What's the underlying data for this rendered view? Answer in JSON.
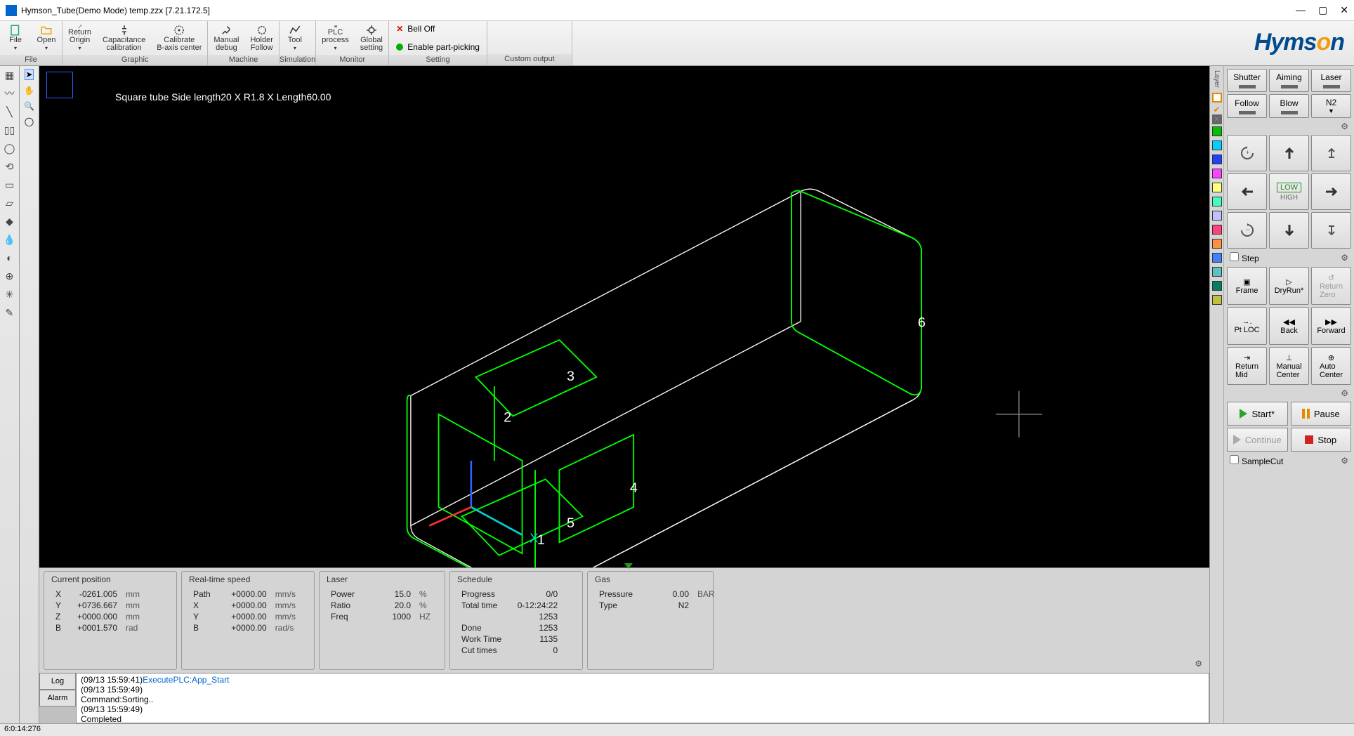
{
  "titlebar": {
    "icon_name": "app-icon",
    "title": "Hymson_Tube(Demo Mode) temp.zzx  [7.21.172.5]"
  },
  "ribbon": {
    "file": {
      "label": "File",
      "items": [
        {
          "label": "File",
          "name": "file-button"
        },
        {
          "label": "Open",
          "name": "open-button"
        }
      ]
    },
    "graphic": {
      "label": "Graphic",
      "items": [
        {
          "label": "Return\nOrigin",
          "name": "return-origin-button"
        },
        {
          "label": "Capacitance\ncalibration",
          "name": "capacitance-calibration-button"
        },
        {
          "label": "Calibrate\nB-axis center",
          "name": "calibrate-b-axis-button"
        }
      ]
    },
    "machine": {
      "label": "Machine",
      "items": [
        {
          "label": "Manual\ndebug",
          "name": "manual-debug-button"
        },
        {
          "label": "Holder\nFollow",
          "name": "holder-follow-button"
        }
      ]
    },
    "simulation": {
      "label": "Simulation",
      "items": [
        {
          "label": "Tool",
          "name": "tool-button"
        }
      ]
    },
    "monitor": {
      "label": "Monitor",
      "items": [
        {
          "label": "PLC\nprocess",
          "name": "plc-process-button"
        },
        {
          "label": "Global\nsetting",
          "name": "global-setting-button"
        }
      ]
    },
    "setting": {
      "label": "Setting",
      "bell_off": "Bell Off",
      "enable_part_picking": "Enable part-picking"
    },
    "custom_output": {
      "label": "Custom output"
    },
    "brand": "Hymson"
  },
  "viewport": {
    "tube_label": "Square tube Side length20 X R1.8 X Length60.00",
    "numbers": [
      "1",
      "2",
      "3",
      "4",
      "5",
      "6"
    ],
    "axis_x": "X"
  },
  "status_panels": {
    "current_position": {
      "title": "Current position",
      "rows": [
        {
          "axis": "X",
          "value": "-0261.005",
          "unit": "mm"
        },
        {
          "axis": "Y",
          "value": "+0736.667",
          "unit": "mm"
        },
        {
          "axis": "Z",
          "value": "+0000.000",
          "unit": "mm"
        },
        {
          "axis": "B",
          "value": "+0001.570",
          "unit": "rad"
        }
      ]
    },
    "real_time_speed": {
      "title": "Real-time speed",
      "rows": [
        {
          "axis": "Path",
          "value": "+0000.00",
          "unit": "mm/s"
        },
        {
          "axis": "X",
          "value": "+0000.00",
          "unit": "mm/s"
        },
        {
          "axis": "Y",
          "value": "+0000.00",
          "unit": "mm/s"
        },
        {
          "axis": "B",
          "value": "+0000.00",
          "unit": "rad/s"
        }
      ]
    },
    "laser": {
      "title": "Laser",
      "rows": [
        {
          "name": "Power",
          "value": "15.0",
          "unit": "%"
        },
        {
          "name": "Ratio",
          "value": "20.0",
          "unit": "%"
        },
        {
          "name": "Freq",
          "value": "1000",
          "unit": "HZ"
        }
      ]
    },
    "schedule": {
      "title": "Schedule",
      "rows": [
        {
          "name": "Progress",
          "value": "0/0"
        },
        {
          "name": "Total time",
          "value": "0-12:24:22"
        },
        {
          "name": "Done",
          "value": "1253"
        },
        {
          "name": "Work Time",
          "value": "1135"
        },
        {
          "name": "Cut times",
          "value": "0"
        }
      ]
    },
    "gas": {
      "title": "Gas",
      "rows": [
        {
          "name": "Pressure",
          "value": "0.00",
          "unit": "BAR"
        },
        {
          "name": "Type",
          "value": "N2",
          "unit": ""
        }
      ]
    }
  },
  "log": {
    "btn_log": "Log",
    "btn_alarm": "Alarm",
    "lines": [
      {
        "ts": "(09/13 15:59:41)",
        "msg": "ExecutePLC:App_Start",
        "hl": true
      },
      {
        "ts": "(09/13 15:59:49)",
        "msg": ""
      },
      {
        "ts": "",
        "msg": "Command:Sorting.."
      },
      {
        "ts": "(09/13 15:59:49)",
        "msg": ""
      },
      {
        "ts": "",
        "msg": "Completed"
      }
    ]
  },
  "statusbar": {
    "left": "6:0:14:276",
    "right": ""
  },
  "right": {
    "layer_label": "Layer",
    "layer_colors": [
      "#ffffff",
      "#ffa500",
      "#ffffff",
      "#00c000",
      "#00cfff",
      "#2040ff",
      "#ff40ff",
      "#ffff80",
      "#40ffc0",
      "#c0c0ff",
      "#ff4080",
      "#ff9040",
      "#4080ff",
      "#60c0c0",
      "#008060",
      "#c0c040"
    ],
    "row1": {
      "shutter": "Shutter",
      "aiming": "Aiming",
      "laser": "Laser"
    },
    "row2": {
      "follow": "Follow",
      "blow": "Blow",
      "n2": "N2"
    },
    "speed_low": "LOW",
    "speed_high": "HIGH",
    "step_label": "Step",
    "actions": {
      "frame": "Frame",
      "dryrun": "DryRun*",
      "return_zero": "Return\nZero",
      "pt_loc": "Pt LOC",
      "back": "Back",
      "forward": "Forward",
      "return_mid": "Return\nMid",
      "manual_center": "Manual\nCenter",
      "auto_center": "Auto\nCenter"
    },
    "run": {
      "start": "Start*",
      "pause": "Pause",
      "continue": "Continue",
      "stop": "Stop"
    },
    "samplecut": "SampleCut"
  }
}
